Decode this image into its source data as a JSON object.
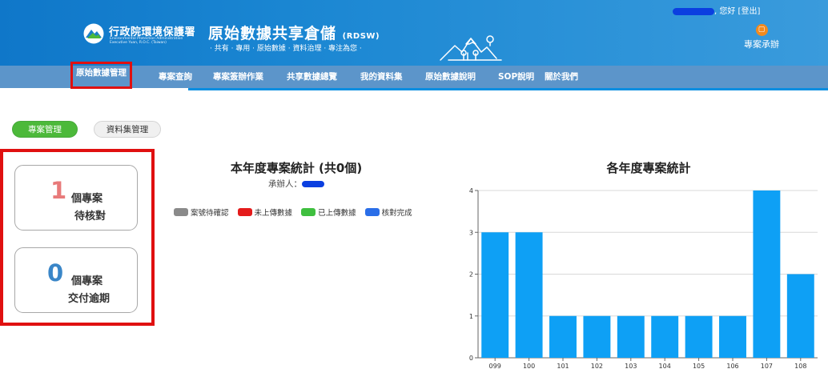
{
  "header": {
    "agency_name": "行政院環境保護署",
    "agency_en_1": "Environmental Protection Administration",
    "agency_en_2": "Executive Yuan, R.O.C. (Taiwan)",
    "site_title": "原始數據共享倉儲",
    "site_abbr": "(RDSW)",
    "slogan": "· 共有 · 專用 · 原始數據 · 資料治理 · 專注為您 ·",
    "greeting": ", 您好",
    "logout": "[登出]",
    "case_button": "專案承辦"
  },
  "nav": {
    "items": [
      "原始數據管理",
      "專案查詢",
      "專案簽辦作業",
      "共享數據總覽",
      "我的資料集",
      "原始數據說明",
      "SOP說明",
      "關於我們"
    ],
    "active_index": 0
  },
  "tabs": {
    "active": "專案管理",
    "inactive": "資料集管理"
  },
  "cards": [
    {
      "count": "1",
      "unit": "個專案",
      "label": "待核對",
      "color": "#e87a7a"
    },
    {
      "count": "0",
      "unit": "個專案",
      "label": "交付逾期",
      "color": "#3a86c8"
    }
  ],
  "year_stats": {
    "title": "本年度專案統計 (共0個)",
    "handler_label": "承辦人：",
    "legend": [
      {
        "label": "案號待確認",
        "color": "#8a8a8a"
      },
      {
        "label": "未上傳數據",
        "color": "#e41b1b"
      },
      {
        "label": "已上傳數據",
        "color": "#3fbf3f"
      },
      {
        "label": "核對完成",
        "color": "#2a6ee8"
      }
    ]
  },
  "chart_data": {
    "type": "bar",
    "title": "各年度專案統計",
    "categories": [
      "099",
      "100",
      "101",
      "102",
      "103",
      "104",
      "105",
      "106",
      "107",
      "108"
    ],
    "values": [
      3,
      3,
      1,
      1,
      1,
      1,
      1,
      1,
      4,
      2
    ],
    "ylim": [
      0,
      4
    ],
    "yticks": [
      0,
      1,
      2,
      3,
      4
    ],
    "grid": true,
    "bar_color": "#0ea0f5",
    "xlabel": "",
    "ylabel": ""
  }
}
